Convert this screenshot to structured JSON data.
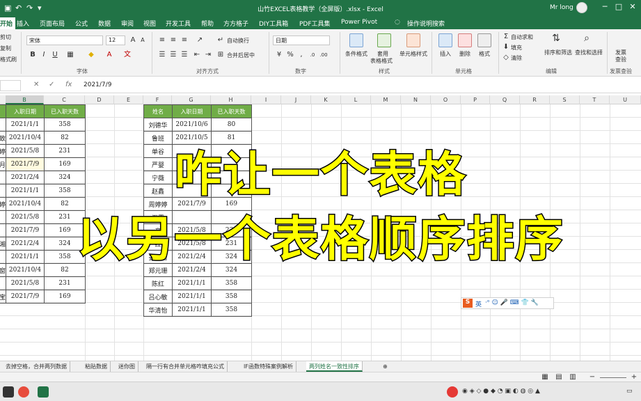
{
  "window": {
    "title": "山竹EXCEL表格教学（全屏版）.xlsx  -  Excel",
    "user": "Mr long",
    "min": "─",
    "max": "□",
    "close": "✕"
  },
  "tabs": [
    "开始",
    "插入",
    "页面布局",
    "公式",
    "数据",
    "审阅",
    "视图",
    "开发工具",
    "帮助",
    "方方格子",
    "DIY工具箱",
    "PDF工具集",
    "Power Pivot"
  ],
  "tell_me": "操作说明搜索",
  "ribbon": {
    "clipboard": [
      "剪切",
      "复制",
      "格式刷"
    ],
    "font_name": "宋体",
    "font_size": "12",
    "font_group": "字体",
    "wrap_text": "自动换行",
    "merge_center": "合并后居中",
    "align_group": "对齐方式",
    "number_format": "日期",
    "number_group": "数字",
    "cond_format": "条件格式",
    "table_format": "套用\n表格格式",
    "cell_styles": "单元格样式",
    "styles_group": "样式",
    "insert": "插入",
    "delete": "删除",
    "format": "格式",
    "cells_group": "单元格",
    "autosum": "自动求和",
    "fill": "填充",
    "clear": "清除",
    "sort_filter": "排序和筛选",
    "find_select": "查找和选择",
    "editing_group": "编辑",
    "invoice_check": "发票\n查验",
    "invoice_group": "发票查验"
  },
  "formula_bar": {
    "cancel": "✕",
    "enter": "✓",
    "fx": "fx",
    "value": "2021/7/9"
  },
  "columns": [
    "B",
    "C",
    "D",
    "E",
    "F",
    "G",
    "H",
    "I",
    "J",
    "K",
    "L",
    "M",
    "N",
    "O",
    "P",
    "Q",
    "R",
    "S",
    "T",
    "U"
  ],
  "left_table": {
    "headers": [
      "入职日期",
      "已入职天数"
    ],
    "rows": [
      [
        "2021/1/1",
        "358"
      ],
      [
        "2021/10/4",
        "82"
      ],
      [
        "2021/5/8",
        "231"
      ],
      [
        "2021/7/9",
        "169"
      ],
      [
        "2021/2/4",
        "324"
      ],
      [
        "2021/1/1",
        "358"
      ],
      [
        "2021/10/4",
        "82"
      ],
      [
        "2021/5/8",
        "231"
      ],
      [
        "2021/7/9",
        "169"
      ],
      [
        "2021/2/4",
        "324"
      ],
      [
        "2021/1/1",
        "358"
      ],
      [
        "2021/10/4",
        "82"
      ],
      [
        "2021/5/8",
        "231"
      ],
      [
        "2021/7/9",
        "169"
      ]
    ]
  },
  "left_partial_names": [
    "",
    "致",
    "婷",
    "月",
    "",
    "",
    "婷",
    "",
    "",
    "湘",
    "",
    "窗",
    "",
    "宝"
  ],
  "right_table": {
    "headers": [
      "姓名",
      "入职日期",
      "已入职天数"
    ],
    "rows": [
      [
        "刘德华",
        "2021/10/6",
        "80"
      ],
      [
        "鲁班",
        "2021/10/5",
        "81"
      ],
      [
        "单谷",
        "",
        ""
      ],
      [
        "严婴",
        "",
        ""
      ],
      [
        "宁薇",
        "",
        ""
      ],
      [
        "赵鑫",
        "",
        ""
      ],
      [
        "周婷婷",
        "2021/7/9",
        "169"
      ],
      [
        "汇霖",
        "",
        ""
      ],
      [
        "帝",
        "2021/5/8",
        "231"
      ],
      [
        "红",
        "2021/5/8",
        "231"
      ],
      [
        "姜清怡",
        "2021/2/4",
        "324"
      ],
      [
        "郑元珊",
        "2021/2/4",
        "324"
      ],
      [
        "陈红",
        "2021/1/1",
        "358"
      ],
      [
        "吕心敏",
        "2021/1/1",
        "358"
      ],
      [
        "华清怡",
        "2021/1/1",
        "358"
      ]
    ]
  },
  "overlay": {
    "line1": "咋让一个表格",
    "line2": "以另一个表格顺序排序"
  },
  "ime": {
    "logo": "S",
    "mode": "英",
    "icons": "·ᵒ ☺ 🎤 ⌨ 👕 🔧"
  },
  "sheet_tabs": [
    "去掉空格，合并两列数据",
    "粘贴数据",
    "迷你图",
    "隔一行有合并单元格咋填充公式",
    "IF函数特殊案例解析",
    "两列姓名一致性排序"
  ],
  "active_sheet": "两列姓名一致性排序",
  "add_sheet": "⊕",
  "colors": {
    "excel_green": "#217346",
    "header_green": "#70ad47",
    "overlay_yellow": "#ffff00"
  }
}
